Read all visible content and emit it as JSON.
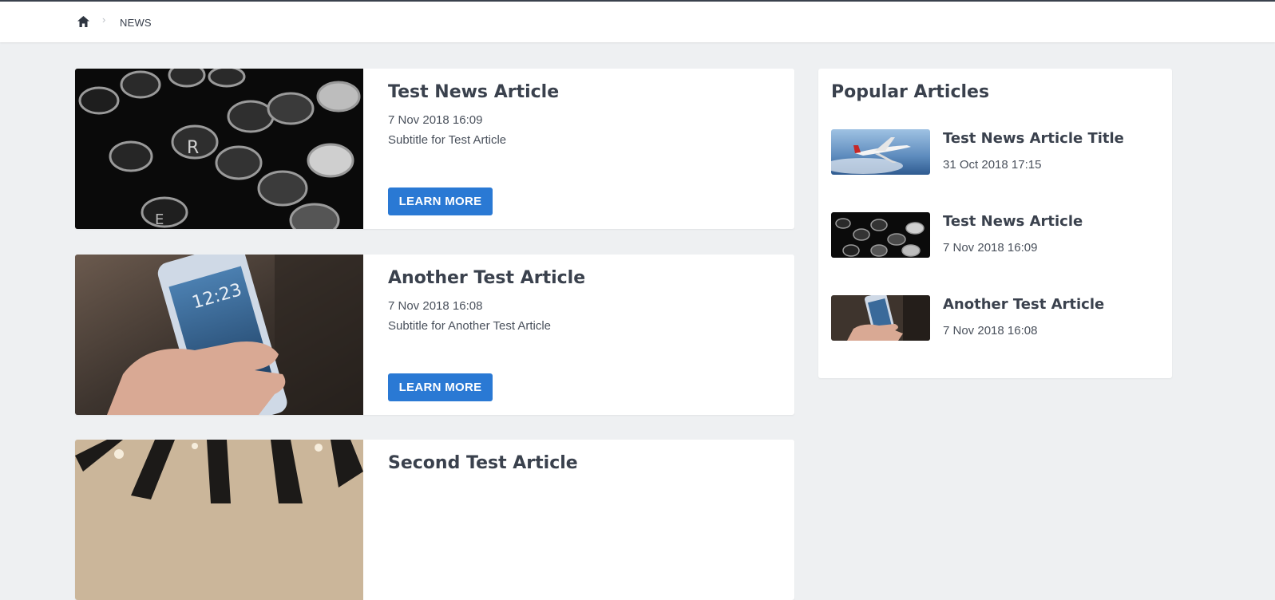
{
  "breadcrumb": {
    "home_icon": "home-icon",
    "separator": "›",
    "current": "NEWS"
  },
  "articles": [
    {
      "title": "Test News Article",
      "date": "7 Nov 2018 16:09",
      "subtitle": "Subtitle for Test Article",
      "button": "LEARN MORE",
      "image": "typewriter-keys"
    },
    {
      "title": "Another Test Article",
      "date": "7 Nov 2018 16:08",
      "subtitle": "Subtitle for Another Test Article",
      "button": "LEARN MORE",
      "image": "hand-holding-phone"
    },
    {
      "title": "Second Test Article",
      "image": "striped-ceiling"
    }
  ],
  "popular": {
    "heading": "Popular Articles",
    "items": [
      {
        "title": "Test News Article Title",
        "date": "31 Oct 2018 17:15",
        "image": "airplane-in-sky"
      },
      {
        "title": "Test News Article",
        "date": "7 Nov 2018 16:09",
        "image": "typewriter-keys"
      },
      {
        "title": "Another Test Article",
        "date": "7 Nov 2018 16:08",
        "image": "hand-holding-phone"
      }
    ]
  },
  "colors": {
    "accent": "#2a79d4",
    "page_bg": "#eef0f2",
    "text": "#3a414d"
  }
}
